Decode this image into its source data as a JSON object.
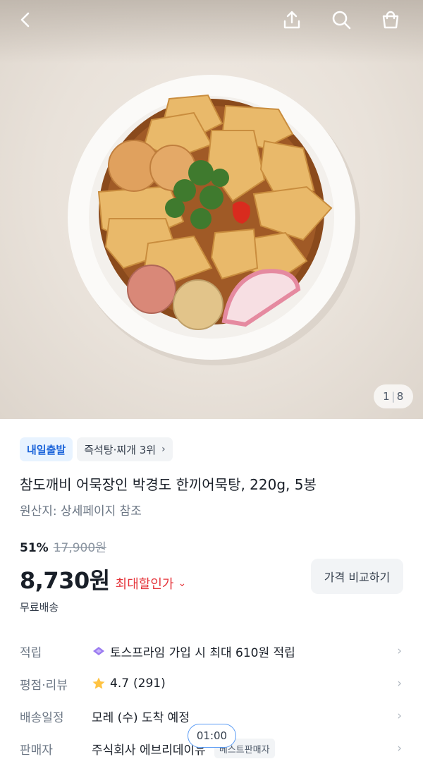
{
  "page_counter": {
    "current": "1",
    "separator": "|",
    "total": "8"
  },
  "badges": {
    "delivery": "내일출발",
    "ranking": "즉석탕·찌개 3위"
  },
  "product": {
    "title": "참도깨비 어묵장인 박경도 한끼어묵탕, 220g, 5봉",
    "origin": "원산지: 상세페이지 참조",
    "discount_rate": "51%",
    "original_price": "17,900원",
    "price": "8,730원",
    "max_discount_label": "최대할인가",
    "compare_button": "가격 비교하기",
    "shipping": "무료배송"
  },
  "rows": {
    "points": {
      "label": "적립",
      "value": "토스프라임 가입 시 최대 610원 적립"
    },
    "rating": {
      "label": "평점·리뷰",
      "score": "4.7",
      "count": "(291)"
    },
    "delivery": {
      "label": "배송일정",
      "value": "모레 (수) 도착 예정"
    },
    "seller": {
      "label": "판매자",
      "value": "주식회사 에브리데이유",
      "badge": "베스트판매자"
    }
  },
  "timer": "01:00",
  "colors": {
    "accent_blue": "#1b64da",
    "discount_red": "#e5343a",
    "star": "#ffc342"
  },
  "icons": [
    "back-icon",
    "share-icon",
    "search-icon",
    "shopping-bag-icon",
    "chevron-right-icon",
    "chevron-down-icon",
    "star-icon",
    "toss-prime-icon"
  ]
}
